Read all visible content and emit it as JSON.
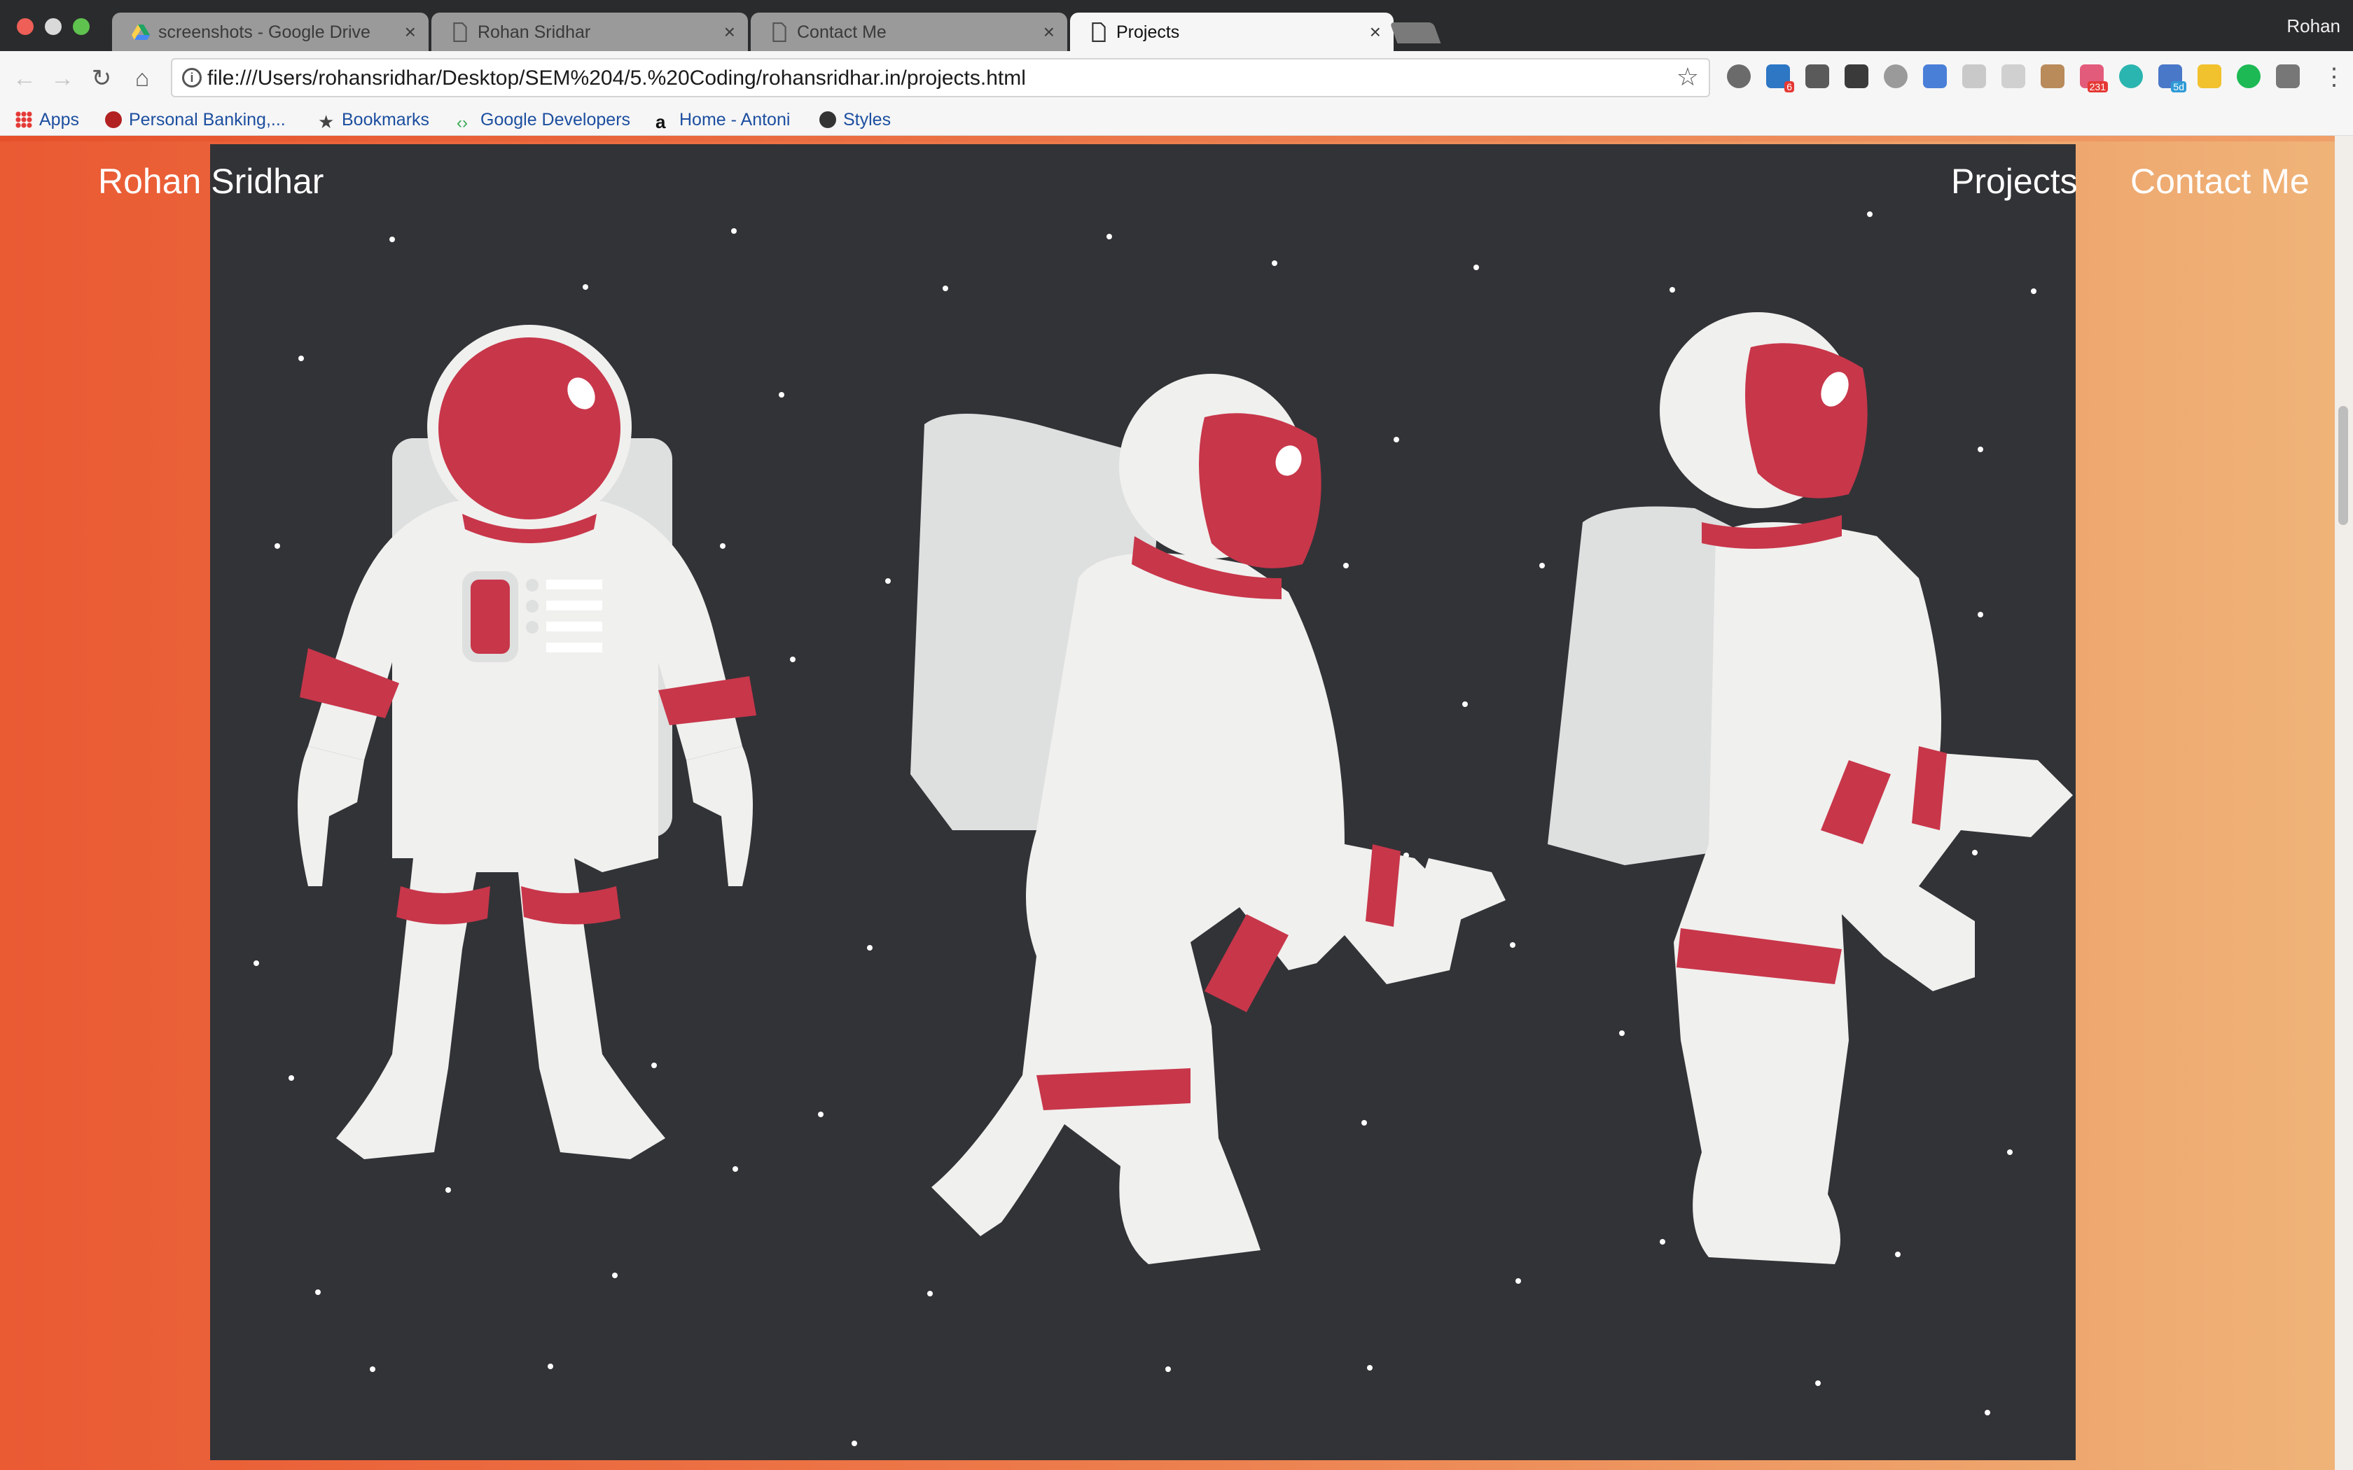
{
  "browser": {
    "tabs": [
      {
        "title": "screenshots - Google Drive",
        "icon": "google-drive-icon"
      },
      {
        "title": "Rohan Sridhar",
        "icon": "document-icon"
      },
      {
        "title": "Contact Me",
        "icon": "document-icon"
      },
      {
        "title": "Projects",
        "icon": "document-icon",
        "active": true
      }
    ],
    "profile": "Rohan",
    "url": "file:///Users/rohansridhar/Desktop/SEM%204/5.%20Coding/rohansridhar.in/projects.html",
    "extension_badges": {
      "notif": "6",
      "count": "231",
      "cal": "5d"
    },
    "bookmarks": [
      {
        "label": "Apps",
        "icon": "apps-grid-icon"
      },
      {
        "label": "Personal Banking,...",
        "icon": "bank-icon"
      },
      {
        "label": "Bookmarks",
        "icon": "star-icon"
      },
      {
        "label": "Google Developers",
        "icon": "google-developers-icon"
      },
      {
        "label": "Home - Antoni",
        "icon": "amazon-icon"
      },
      {
        "label": "Styles",
        "icon": "styles-icon"
      }
    ]
  },
  "page": {
    "brand": "Rohan Sridhar",
    "nav": {
      "projects": "Projects",
      "contact": "Contact Me"
    },
    "colors": {
      "gradient_start": "#ea5a33",
      "gradient_end": "#efb479",
      "hero_bg": "#323337",
      "suit": "#f0f0ee",
      "accent": "#c8364a"
    }
  }
}
